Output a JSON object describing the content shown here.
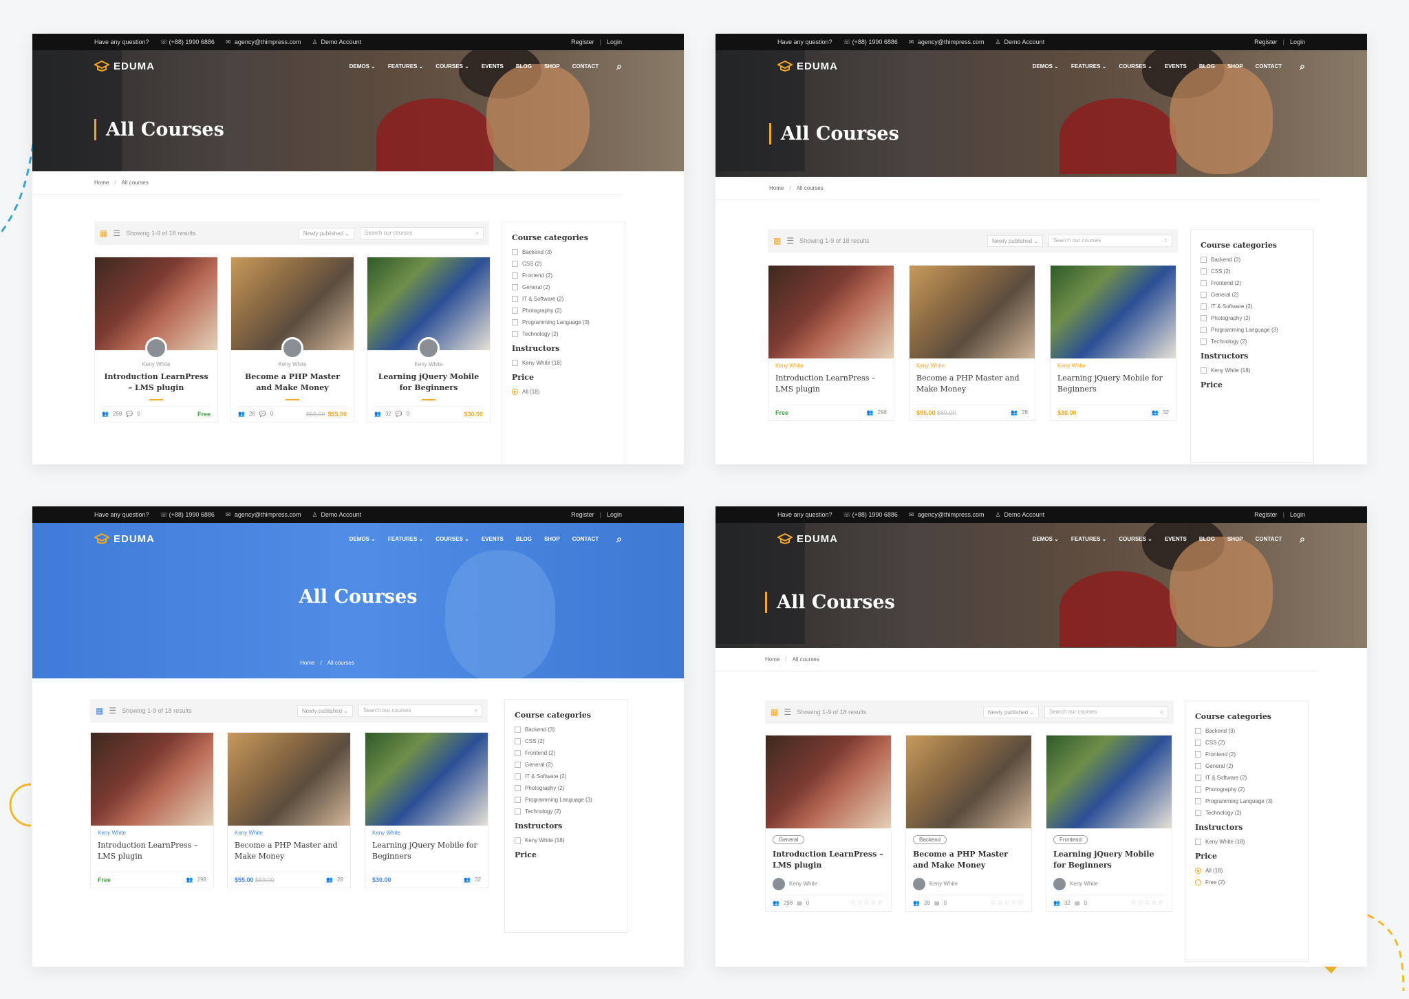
{
  "topbar": {
    "question": "Have any question?",
    "phone": "(+88) 1990 6886",
    "email": "agency@thimpress.com",
    "demo": "Demo Account",
    "register": "Register",
    "login": "Login",
    "separator": "|"
  },
  "nav": {
    "logo": "EDUMA",
    "items": [
      "DEMOS ⌄",
      "FEATURES ⌄",
      "COURSES ⌄",
      "EVENTS",
      "BLOG",
      "SHOP",
      "CONTACT"
    ],
    "search_icon": "search-icon"
  },
  "page": {
    "title": "All Courses",
    "breadcrumb_home": "Home",
    "breadcrumb_sep": "/",
    "breadcrumb_current": "All courses"
  },
  "toolbar": {
    "results": "Showing 1-9 of 18 results",
    "sort": "Newly published ⌄",
    "search_placeholder": "Search our courses",
    "search_icon": "⌕"
  },
  "courses": [
    {
      "title": "Introduction LearnPress – LMS plugin",
      "instructor": "Keny White",
      "students": "298",
      "comments": "0",
      "price": "Free",
      "old_price": "",
      "category": "General",
      "badge": "Free"
    },
    {
      "title": "Become a PHP Master and Make Money",
      "instructor": "Keny White",
      "students": "28",
      "comments": "0",
      "price": "$55.00",
      "old_price": "$69.00",
      "category": "Backend",
      "badge": "$69.00 $55.00"
    },
    {
      "title": "Learning jQuery Mobile for Beginners",
      "instructor": "Keny White",
      "students": "32",
      "comments": "0",
      "price": "$30.00",
      "old_price": "",
      "category": "Frontend",
      "badge": "$30.00"
    }
  ],
  "sidebar": {
    "categories_title": "Course categories",
    "categories": [
      "Backend (3)",
      "CSS (2)",
      "Frontend (2)",
      "General (2)",
      "IT & Software (2)",
      "Photography (2)",
      "Programming Language (3)",
      "Technology (2)"
    ],
    "instructors_title": "Instructors",
    "instructors": [
      "Keny White (18)"
    ],
    "price_title": "Price",
    "price_options": [
      "All (18)",
      "Free (2)"
    ]
  },
  "colors": {
    "accent": "#f5a623",
    "blue": "#4a86e0",
    "free": "#44a245",
    "dark": "#111111"
  }
}
